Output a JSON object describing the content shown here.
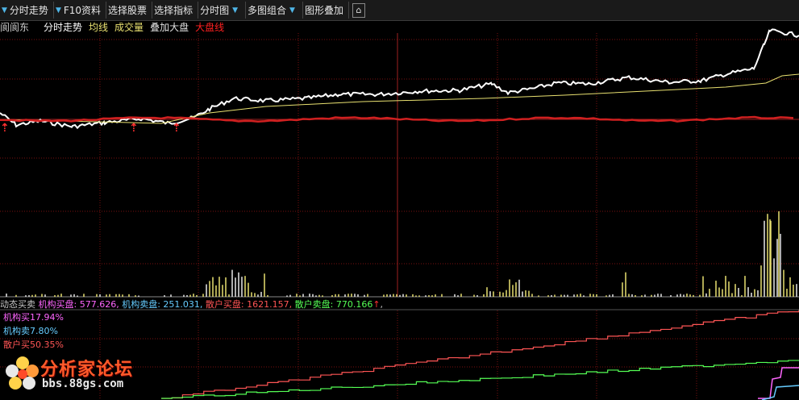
{
  "toolbar": {
    "items": [
      {
        "label": "分时走势",
        "arrow": true
      },
      {
        "label": "F10资料",
        "arrow": true
      },
      {
        "label": "选择股票",
        "arrow": false
      },
      {
        "label": "选择指标",
        "arrow": false
      },
      {
        "label": "分时图",
        "arrow": true
      },
      {
        "label": "多图组合",
        "arrow": true
      },
      {
        "label": "图形叠加",
        "arrow": false
      }
    ]
  },
  "legend": {
    "stock": "阆阆东",
    "intraday": "分时走势",
    "avg": "均线",
    "volume": "成交量",
    "overlay": "叠加大盘",
    "market": "大盘线"
  },
  "flow": {
    "title": "动态买卖",
    "inst_buy_label": "机构买盘:",
    "inst_buy_value": "577.626,",
    "inst_sell_label": "机构卖盘:",
    "inst_sell_value": "251.031,",
    "retail_buy_label": "散户买盘:",
    "retail_buy_value": "1621.157,",
    "retail_sell_label": "散户卖盘:",
    "retail_sell_value": "770.166"
  },
  "percents": {
    "inst_buy": "机构买17.94%",
    "inst_sell": "机构卖7.80%",
    "retail_buy": "散户买50.35%"
  },
  "watermark": {
    "name": "分析家论坛",
    "url": "bbs.88gs.com"
  },
  "colors": {
    "price": "#ffffff",
    "avg": "#e8e070",
    "market": "#d02020",
    "inst_buy": "#ff66ff",
    "inst_sell": "#66ccff",
    "retail_buy": "#ff5555",
    "retail_sell": "#55ff55",
    "arrow_up": "#ff3030",
    "grid": "#7a1010"
  }
}
